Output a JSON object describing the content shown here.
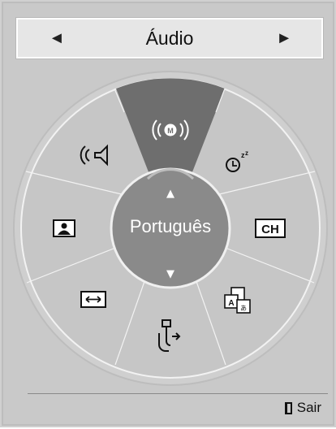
{
  "header": {
    "left_arrow": "◄",
    "title": "Áudio",
    "right_arrow": "►"
  },
  "wheel": {
    "center_label": "Português",
    "up_arrow": "▲",
    "down_arrow": "▼",
    "segments": [
      {
        "name": "audio-mode",
        "icon": "audio-mode-icon"
      },
      {
        "name": "sleep-timer",
        "icon": "sleep-timer-icon"
      },
      {
        "name": "channel",
        "label": "CH"
      },
      {
        "name": "subtitle-language",
        "icon": "subtitle-language-icon"
      },
      {
        "name": "input",
        "icon": "input-icon"
      },
      {
        "name": "aspect-ratio",
        "icon": "aspect-ratio-icon"
      },
      {
        "name": "picture",
        "icon": "picture-icon"
      },
      {
        "name": "sound",
        "icon": "speaker-icon"
      }
    ],
    "selected": "audio-mode",
    "colors": {
      "selected": "#6e6e6e",
      "ring": "#c6c6c6",
      "center": "#8a8a8a"
    }
  },
  "footer": {
    "exit_label": "Sair"
  }
}
